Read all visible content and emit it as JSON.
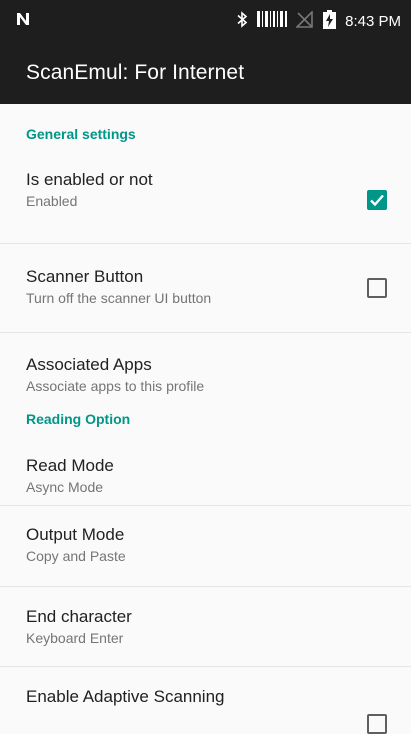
{
  "status_bar": {
    "time": "8:43 PM",
    "icons": [
      "n-notification-icon",
      "bluetooth-icon",
      "barcode-icon",
      "no-signal-icon",
      "battery-charging-icon"
    ]
  },
  "app_bar": {
    "title": "ScanEmul: For Internet"
  },
  "colors": {
    "accent": "#009688",
    "app_bar": "#1e1e1e",
    "background": "#fafafa",
    "top_accent": "#21a0e8"
  },
  "sections": [
    {
      "title": "General settings",
      "items": [
        {
          "title": "Is enabled or not",
          "summary": "Enabled",
          "checkbox": true
        },
        {
          "title": "Scanner Button",
          "summary": "Turn off the scanner UI button",
          "checkbox": false
        },
        {
          "title": "Associated Apps",
          "summary": "Associate apps to this profile",
          "checkbox": null
        }
      ]
    },
    {
      "title": "Reading Option",
      "items": [
        {
          "title": "Read Mode",
          "summary": "Async Mode",
          "checkbox": null
        },
        {
          "title": "Output Mode",
          "summary": "Copy and Paste",
          "checkbox": null
        },
        {
          "title": "End character",
          "summary": "Keyboard Enter",
          "checkbox": null
        },
        {
          "title": "Enable Adaptive Scanning",
          "summary": "",
          "checkbox": false
        }
      ]
    }
  ]
}
